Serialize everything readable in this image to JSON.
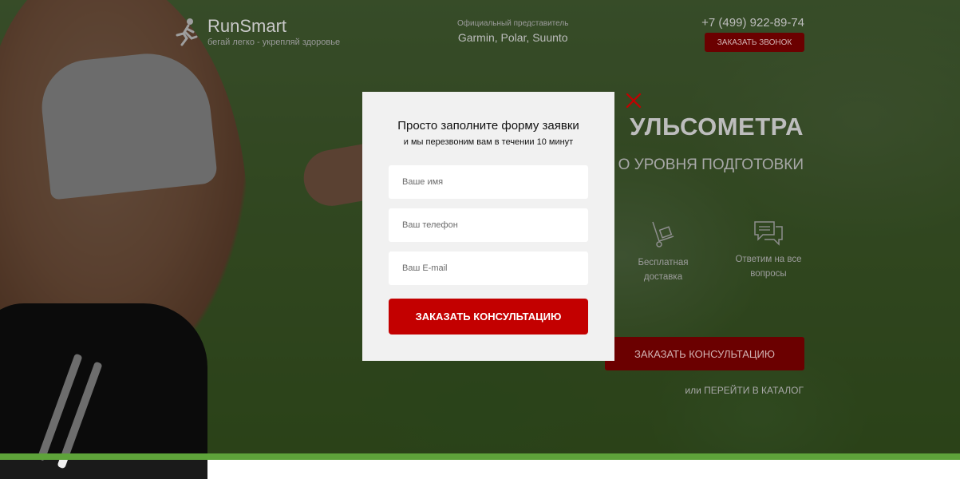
{
  "brand": {
    "name": "RunSmart",
    "tagline": "бегай легко - укрепляй здоровье"
  },
  "header": {
    "official_label": "Официальный представитель",
    "brands": "Garmin, Polar, Suunto",
    "phone": "+7 (499) 922-89-74",
    "call_button": "ЗАКАЗАТЬ ЗВОНОК"
  },
  "hero": {
    "title_visible": "УЛЬСОМЕТРА",
    "subtitle_visible": "О УРОВНЯ ПОДГОТОВКИ",
    "features": [
      {
        "icon": "delivery-cart-icon",
        "label": "Бесплатная доставка"
      },
      {
        "icon": "chat-bubbles-icon",
        "label": "Ответим на все вопросы"
      }
    ],
    "cta": "ЗАКАЗАТЬ КОНСУЛЬТАЦИЮ",
    "catalog_prefix": "или",
    "catalog_link": "ПЕРЕЙТИ В КАТАЛОГ"
  },
  "modal": {
    "title": "Просто заполните форму заявки",
    "subtitle": "и мы перезвоним вам в течении 10 минут",
    "fields": {
      "name_placeholder": "Ваше имя",
      "phone_placeholder": "Ваш телефон",
      "email_placeholder": "Ваш E-mail"
    },
    "submit": "ЗАКАЗАТЬ КОНСУЛЬТАЦИЮ"
  },
  "colors": {
    "accent": "#c30000",
    "accent_dim": "#6b0000",
    "modal_bg": "#f1f1f1"
  }
}
